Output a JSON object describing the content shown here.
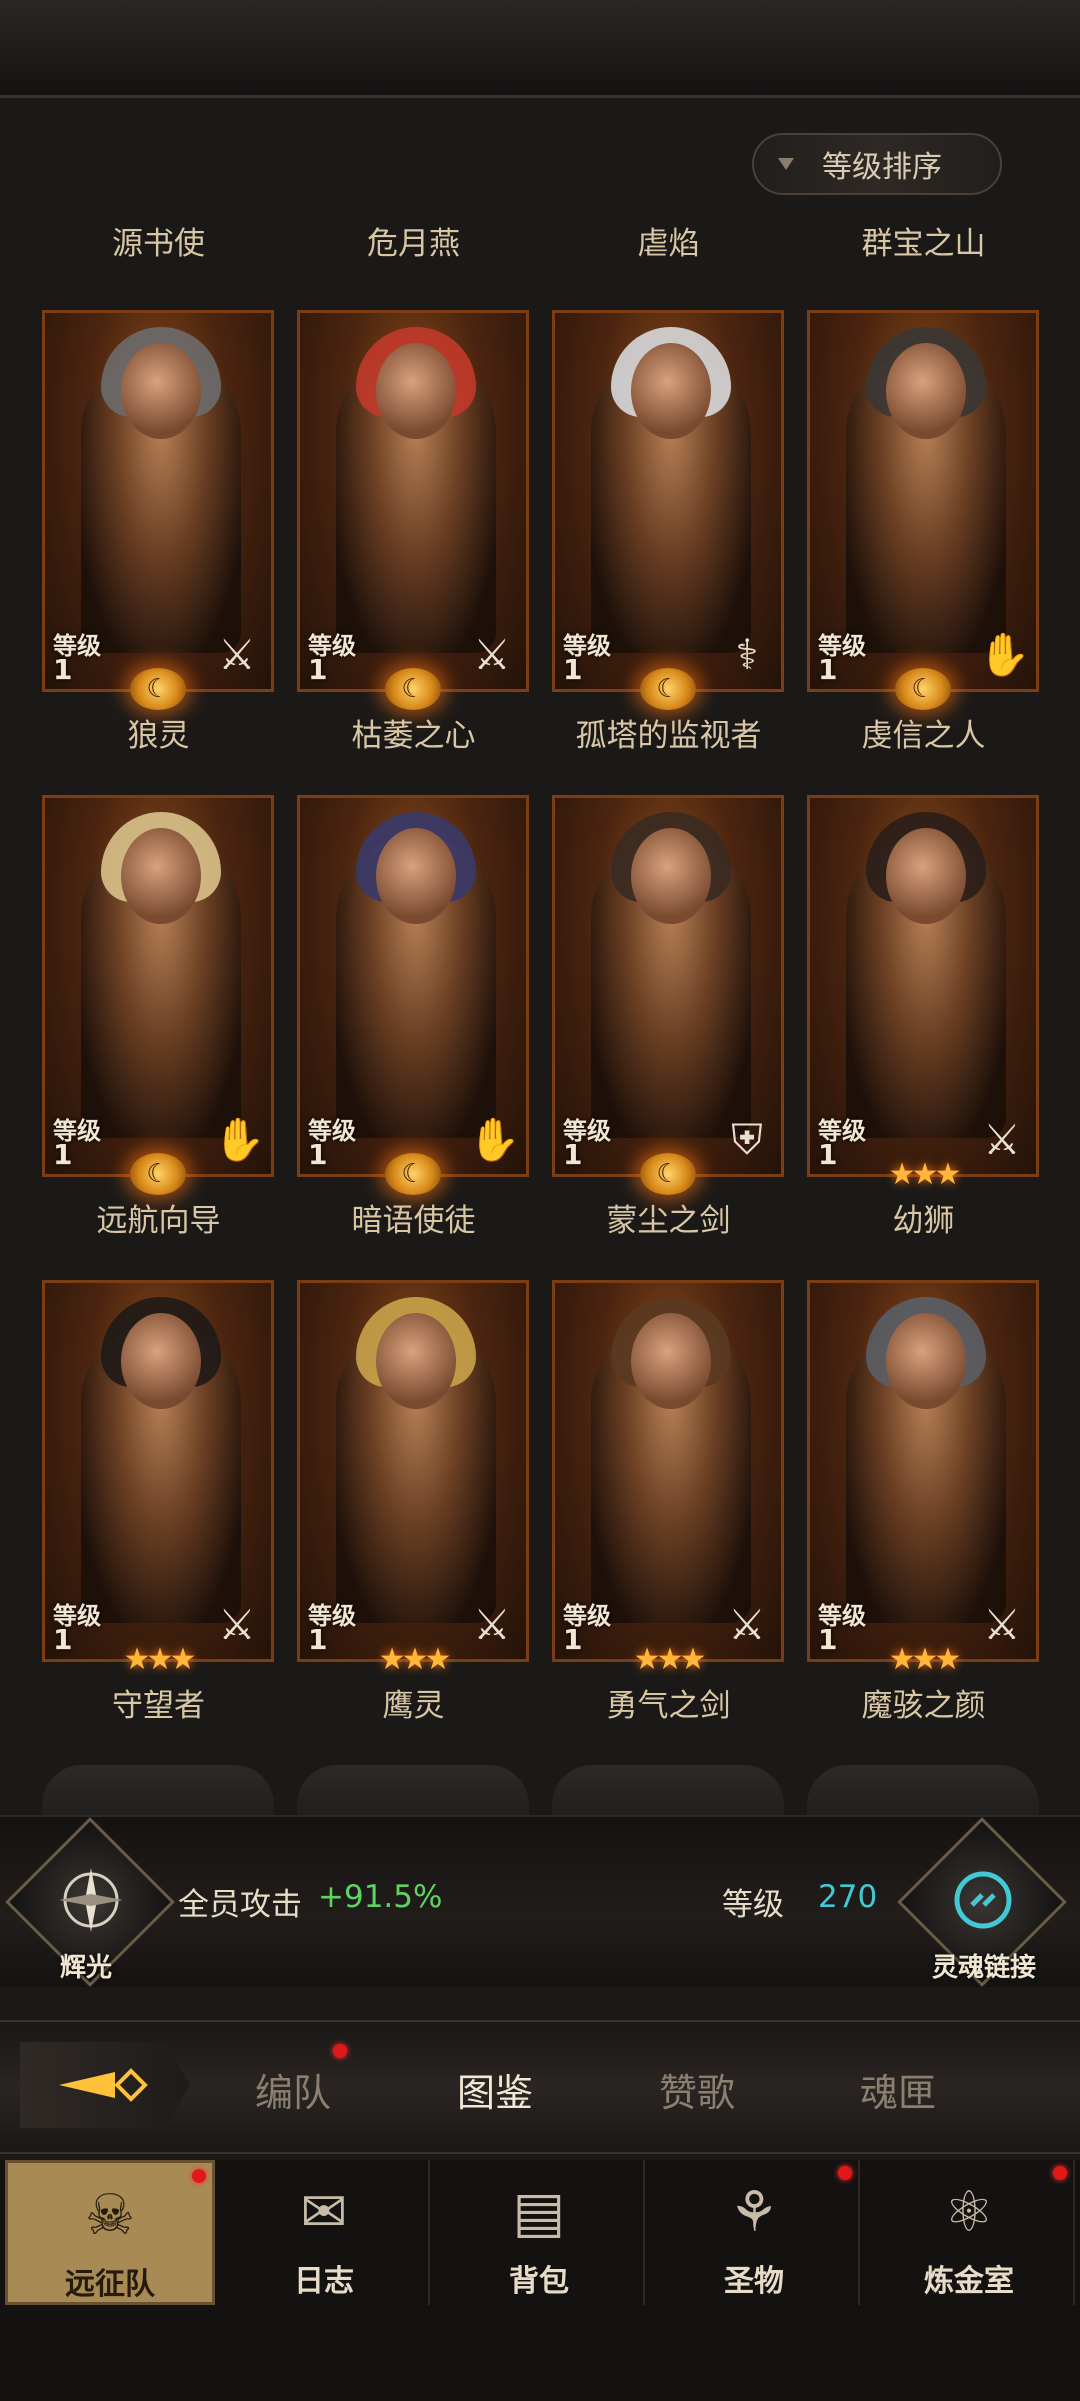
{
  "sort": {
    "label": "等级排序"
  },
  "top_names": [
    "源书使",
    "危月燕",
    "虐焰",
    "群宝之山"
  ],
  "level_label": "等级",
  "heroes": [
    {
      "name": "狼灵",
      "level": "1",
      "class_icon": "sword-icon",
      "badge": "moon",
      "hair": "#6b6b6b"
    },
    {
      "name": "枯萎之心",
      "level": "1",
      "class_icon": "sword-icon",
      "badge": "moon",
      "hair": "#c23a2a"
    },
    {
      "name": "孤塔的监视者",
      "level": "1",
      "class_icon": "staff-icon",
      "badge": "moon",
      "hair": "#d8d8dc"
    },
    {
      "name": "虔信之人",
      "level": "1",
      "class_icon": "hand-icon",
      "badge": "moon",
      "hair": "#3a3634"
    },
    {
      "name": "远航向导",
      "level": "1",
      "class_icon": "hand-icon",
      "badge": "moon",
      "hair": "#d9c28a"
    },
    {
      "name": "暗语使徒",
      "level": "1",
      "class_icon": "hand-icon",
      "badge": "moon",
      "hair": "#3a3a6a"
    },
    {
      "name": "蒙尘之剑",
      "level": "1",
      "class_icon": "shield-icon",
      "badge": "moon",
      "hair": "#3a2a22"
    },
    {
      "name": "幼狮",
      "level": "1",
      "class_icon": "sword-icon",
      "badge": "stars",
      "hair": "#2a1e1a"
    },
    {
      "name": "守望者",
      "level": "1",
      "class_icon": "sword-icon",
      "badge": "stars",
      "hair": "#1e1a18"
    },
    {
      "name": "鹰灵",
      "level": "1",
      "class_icon": "sword-icon",
      "badge": "stars",
      "hair": "#c9a34a"
    },
    {
      "name": "勇气之剑",
      "level": "1",
      "class_icon": "sword-icon",
      "badge": "stars",
      "hair": "#5a3a22"
    },
    {
      "name": "魔骇之颜",
      "level": "1",
      "class_icon": "sword-icon",
      "badge": "stars",
      "hair": "#5a5e66"
    }
  ],
  "stats": {
    "left_emblem_label": "辉光",
    "attack_label": "全员攻击",
    "attack_value": "+91.5%",
    "level_label": "等级",
    "level_value": "270",
    "right_emblem_label": "灵魂链接"
  },
  "tabs": [
    {
      "label": "编队",
      "dot": true
    },
    {
      "label": "图鉴",
      "dot": false,
      "active": true
    },
    {
      "label": "赞歌",
      "dot": false
    },
    {
      "label": "魂匣",
      "dot": false
    }
  ],
  "nav": [
    {
      "label": "远征队",
      "icon": "horned-helmet-icon",
      "active": true,
      "dot": true
    },
    {
      "label": "日志",
      "icon": "scroll-icon",
      "active": false,
      "dot": false
    },
    {
      "label": "背包",
      "icon": "backpack-icon",
      "active": false,
      "dot": false
    },
    {
      "label": "圣物",
      "icon": "torch-icon",
      "active": false,
      "dot": true
    },
    {
      "label": "炼金室",
      "icon": "alchemy-icon",
      "active": false,
      "dot": true
    }
  ],
  "colors": {
    "accent_green": "#5fd35f",
    "accent_cyan": "#43c9d6",
    "notification_red": "#e01818"
  }
}
